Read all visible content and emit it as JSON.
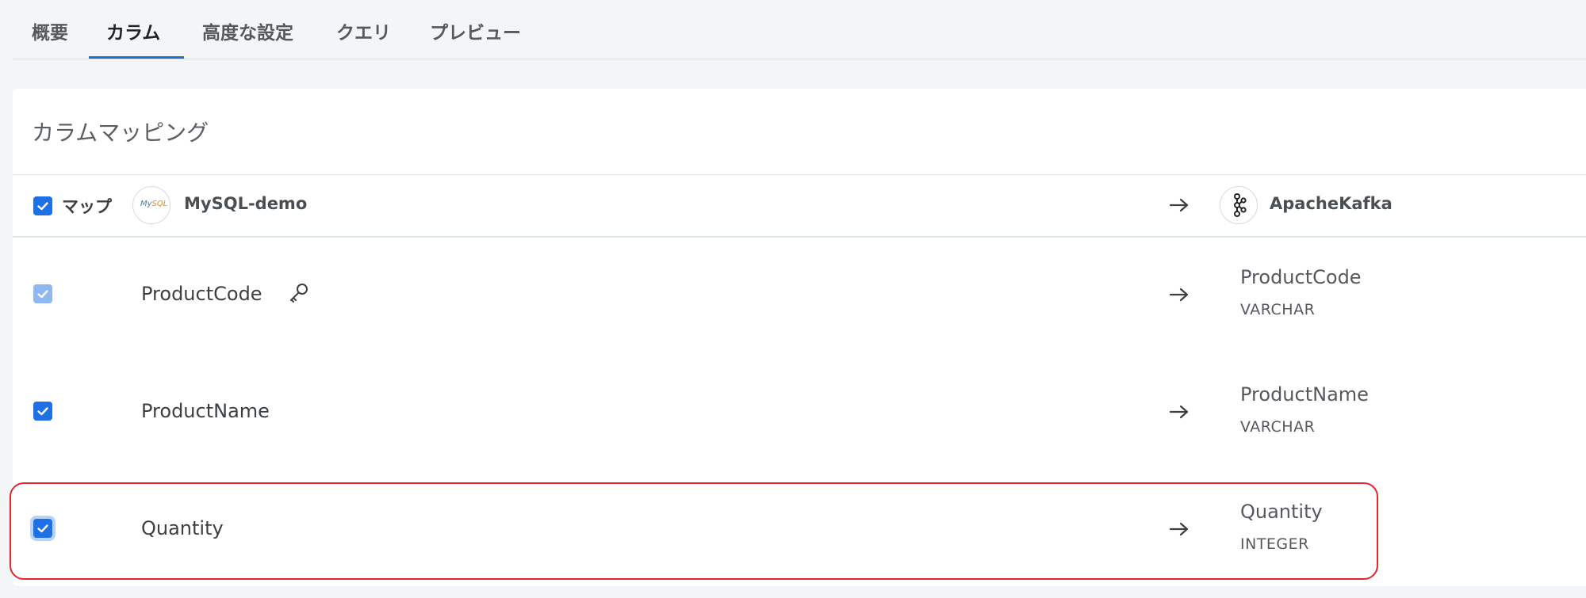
{
  "tabs": [
    {
      "label": "概要"
    },
    {
      "label": "カラム"
    },
    {
      "label": "高度な設定"
    },
    {
      "label": "クエリ"
    },
    {
      "label": "プレビュー"
    }
  ],
  "active_tab": "カラム",
  "section": {
    "title": "カラムマッピング"
  },
  "header": {
    "map_label": "マップ",
    "source_name": "MySQL-demo",
    "destination_name": "ApacheKafka",
    "source_logo_text": "MySQL",
    "select_all_checked": true
  },
  "rows": [
    {
      "source": "ProductCode",
      "is_key": true,
      "dest_name": "ProductCode",
      "dest_type": "VARCHAR",
      "checked": true,
      "disabled": true
    },
    {
      "source": "ProductName",
      "is_key": false,
      "dest_name": "ProductName",
      "dest_type": "VARCHAR",
      "checked": true,
      "disabled": false
    },
    {
      "source": "Quantity",
      "is_key": false,
      "dest_name": "Quantity",
      "dest_type": "INTEGER",
      "checked": true,
      "disabled": false
    }
  ],
  "icons": {
    "arrow": "arrow-right-icon",
    "key": "key-icon",
    "kafka": "kafka-logo-icon",
    "mysql": "mysql-logo-icon",
    "check": "check-icon"
  },
  "colors": {
    "checkbox": "#1f6fe5",
    "checkbox_disabled": "#8fb7f2",
    "tab_underline": "#1f6fd1",
    "highlight": "#e0262e"
  }
}
